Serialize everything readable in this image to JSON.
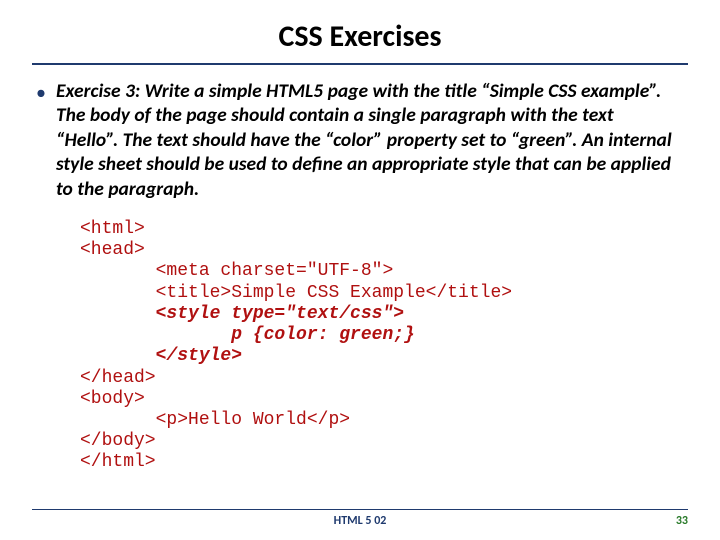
{
  "title": "CSS Exercises",
  "exercise": {
    "text": "Exercise 3: Write a simple HTML5 page with the title “Simple CSS example”. The body of the page should contain a single paragraph with the text “Hello”. The text should have the “color” property set to “green”. An internal style sheet should be used to define an appropriate style that can be applied to the paragraph."
  },
  "code": {
    "l1": "<html>",
    "l2": "<head>",
    "l3": "       <meta charset=\"UTF-8\">",
    "l4": "       <title>Simple CSS Example</title>",
    "l5": "       <style type=\"text/css\">",
    "l6": "              p {color: green;}",
    "l7": "       </style>",
    "l8": "</head>",
    "l9": "<body>",
    "l10": "       <p>Hello World</p>",
    "l11": "</body>",
    "l12": "</html>"
  },
  "footer": {
    "center": "HTML 5 02",
    "right": "33"
  }
}
